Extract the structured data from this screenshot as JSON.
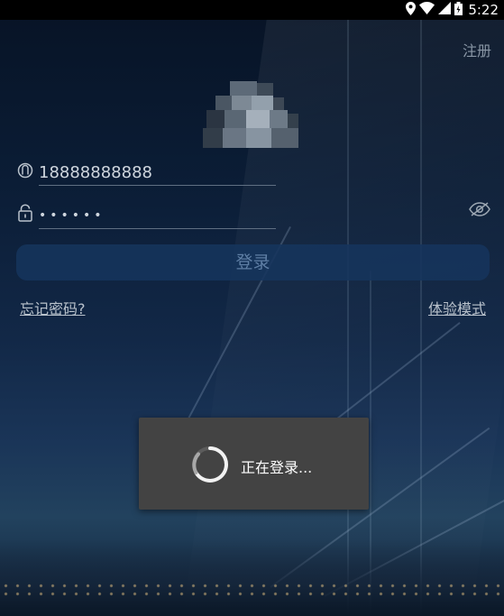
{
  "status_bar": {
    "time": "5:22",
    "icons": [
      "location-icon",
      "wifi-icon",
      "signal-icon",
      "battery-icon"
    ]
  },
  "header": {
    "register_label": "注册"
  },
  "login_form": {
    "phone_value": "18888888888",
    "password_value": "••••••",
    "login_button_label": "登录",
    "forgot_password_label": "忘记密码?",
    "trial_mode_label": "体验模式"
  },
  "loading_dialog": {
    "message": "正在登录..."
  },
  "colors": {
    "status_bar": "#000000",
    "login_button": "#16345c",
    "dialog_bg": "#434343"
  }
}
